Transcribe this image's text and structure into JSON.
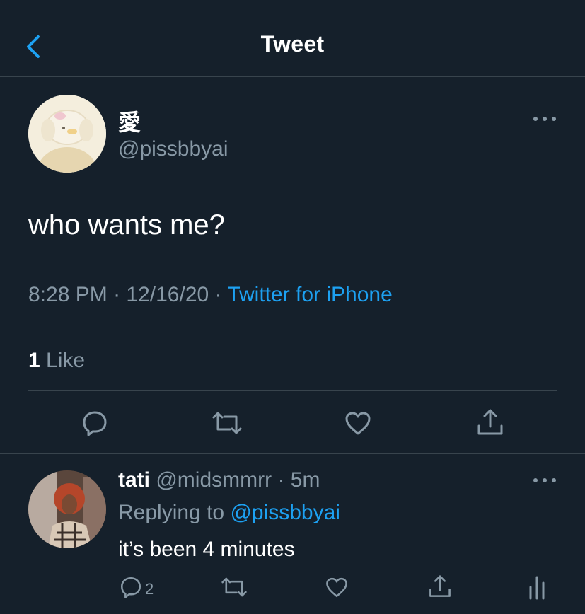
{
  "header": {
    "title": "Tweet",
    "back_icon": "chevron-left-icon"
  },
  "tweet": {
    "display_name": "愛",
    "handle": "@pissbbyai",
    "text": "who wants me?",
    "time": "8:28 PM",
    "date": "12/16/20",
    "separator": "·",
    "source": "Twitter for iPhone",
    "like_count": "1",
    "like_label": "Like",
    "actions": [
      "reply-icon",
      "retweet-icon",
      "like-icon",
      "share-icon"
    ]
  },
  "reply": {
    "display_name": "tati",
    "handle": "@midsmmrr",
    "time": "5m",
    "replying_prefix": "Replying to",
    "replying_handle": "@pissbbyai",
    "text": "it’s been 4 minutes",
    "reply_count": "2",
    "actions": [
      "reply-icon",
      "retweet-icon",
      "like-icon",
      "share-icon",
      "analytics-icon"
    ]
  },
  "colors": {
    "background": "#15202b",
    "accent": "#1da1f2",
    "muted": "#8899a6",
    "divider": "#38444d"
  }
}
